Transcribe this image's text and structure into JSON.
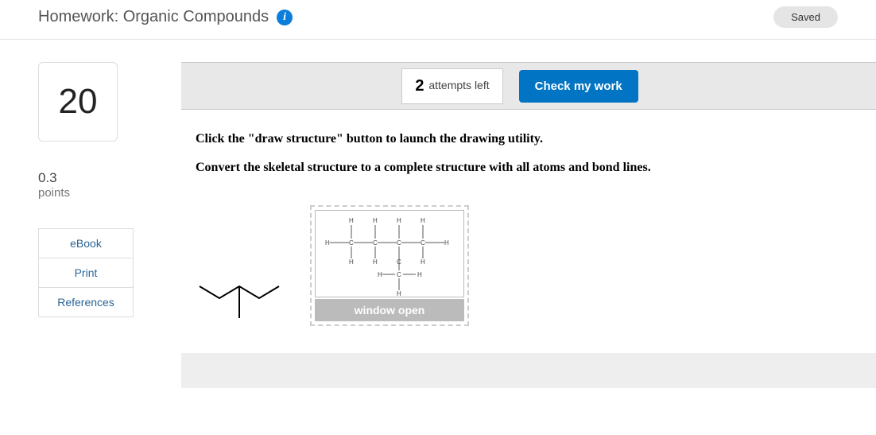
{
  "header": {
    "title": "Homework: Organic Compounds",
    "saved_label": "Saved"
  },
  "sidebar": {
    "question_number": "20",
    "points_value": "0.3",
    "points_label": "points",
    "links": {
      "ebook": "eBook",
      "print": "Print",
      "references": "References"
    }
  },
  "toolbar": {
    "attempts_count": "2",
    "attempts_label": " attempts left",
    "check_label": "Check my work"
  },
  "instructions": {
    "line1": "Click the \"draw structure\" button to launch the drawing utility.",
    "line2": "Convert the skeletal structure to a complete structure with all atoms and bond lines."
  },
  "draw_widget": {
    "status_label": "window open"
  }
}
